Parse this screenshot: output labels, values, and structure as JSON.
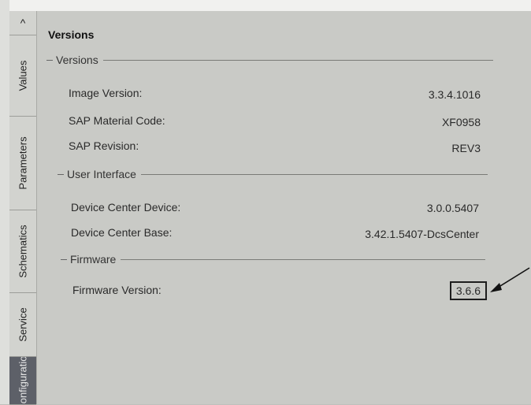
{
  "tabs": {
    "collapse": "^",
    "values": "Values",
    "parameters": "Parameters",
    "schematics": "Schematics",
    "service": "Service",
    "configuration": "Configuration"
  },
  "panel": {
    "title": "Versions",
    "groups": {
      "versions": {
        "header": "Versions",
        "rows": [
          {
            "label": "Image Version:",
            "value": "3.3.4.1016"
          },
          {
            "label": "SAP Material Code:",
            "value": "XF0958"
          },
          {
            "label": "SAP Revision:",
            "value": "REV3"
          }
        ]
      },
      "ui": {
        "header": "User Interface",
        "rows": [
          {
            "label": "Device Center Device:",
            "value": "3.0.0.5407"
          },
          {
            "label": "Device Center Base:",
            "value": "3.42.1.5407-DcsCenter"
          }
        ]
      },
      "firmware": {
        "header": "Firmware",
        "rows": [
          {
            "label": "Firmware Version:",
            "value": "3.6.6"
          }
        ]
      }
    }
  }
}
